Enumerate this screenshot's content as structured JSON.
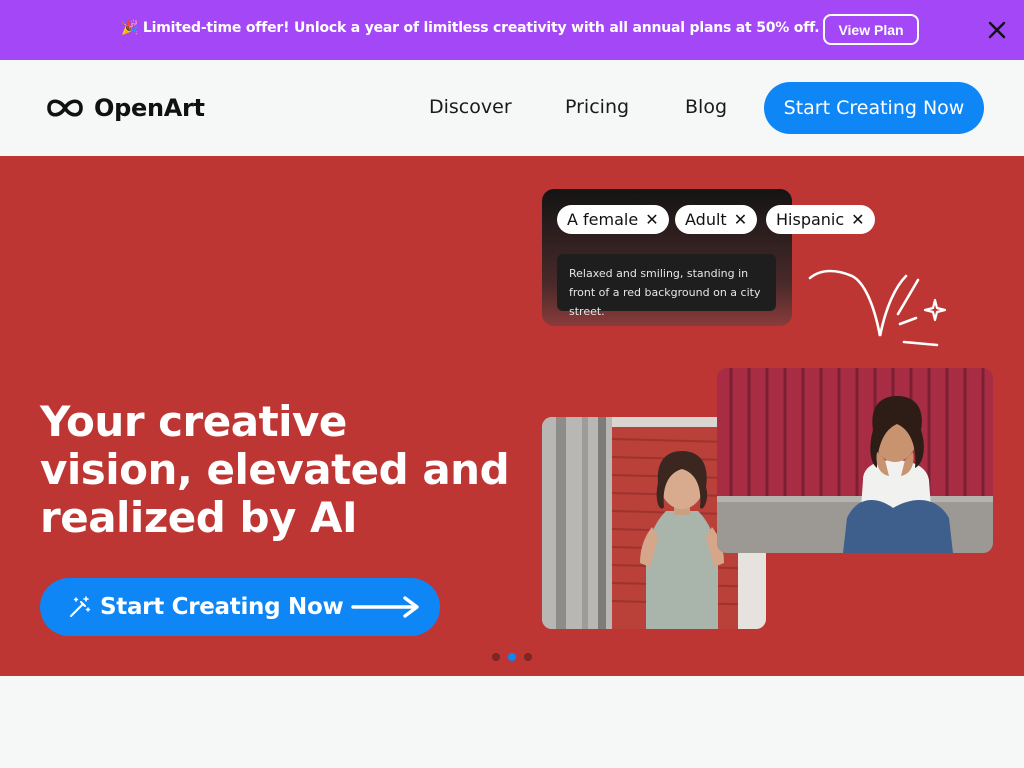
{
  "promo": {
    "text": "🎉 Limited-time offer! Unlock a year of limitless creativity with all annual plans at 50% off.",
    "button_label": "View Plan"
  },
  "nav": {
    "brand": "OpenArt",
    "links": [
      "Discover",
      "Pricing",
      "Blog"
    ],
    "cta_label": "Start Creating Now"
  },
  "hero": {
    "headline": "Your creative vision, elevated and realized by AI",
    "cta_label": "Start Creating Now",
    "prompt_chips": [
      "A female",
      "Adult",
      "Hispanic"
    ],
    "prompt_text": "Relaxed and smiling, standing in front of a red background on a city street.",
    "carousel": {
      "count": 3,
      "active_index": 1
    }
  },
  "colors": {
    "promo_bg": "#a347f7",
    "hero_bg": "#bd3633",
    "accent_blue": "#0f86f6"
  }
}
